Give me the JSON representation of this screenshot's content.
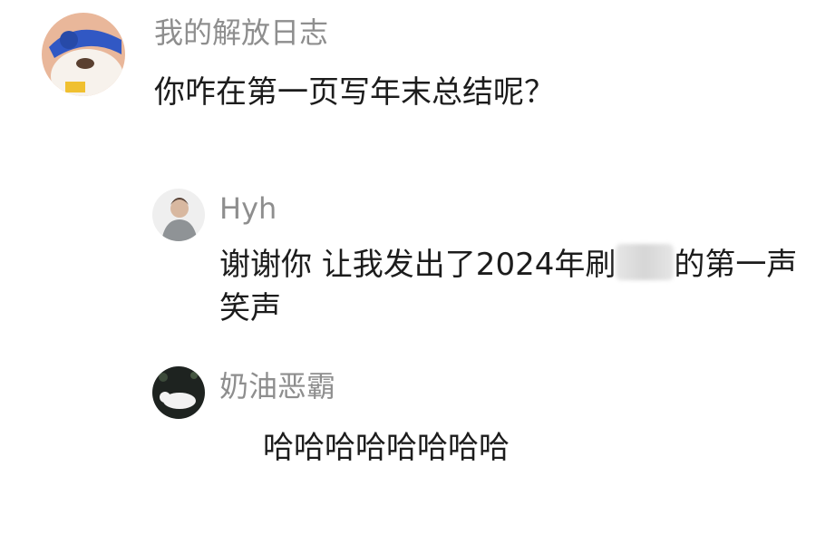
{
  "comments": [
    {
      "username": "我的解放日志",
      "text": "你咋在第一页写年末总结呢？",
      "avatar_icon": "cartoon-hamster-avatar-icon"
    }
  ],
  "replies": [
    {
      "username": "Hyh",
      "text_before_redaction": "谢谢你 让我发出了2024年刷",
      "text_after_redaction": "的第一声笑声",
      "avatar_icon": "person-avatar-icon"
    },
    {
      "username": "奶油恶霸",
      "text": "哈哈哈哈哈哈哈哈",
      "avatar_icon": "white-cat-avatar-icon"
    }
  ]
}
